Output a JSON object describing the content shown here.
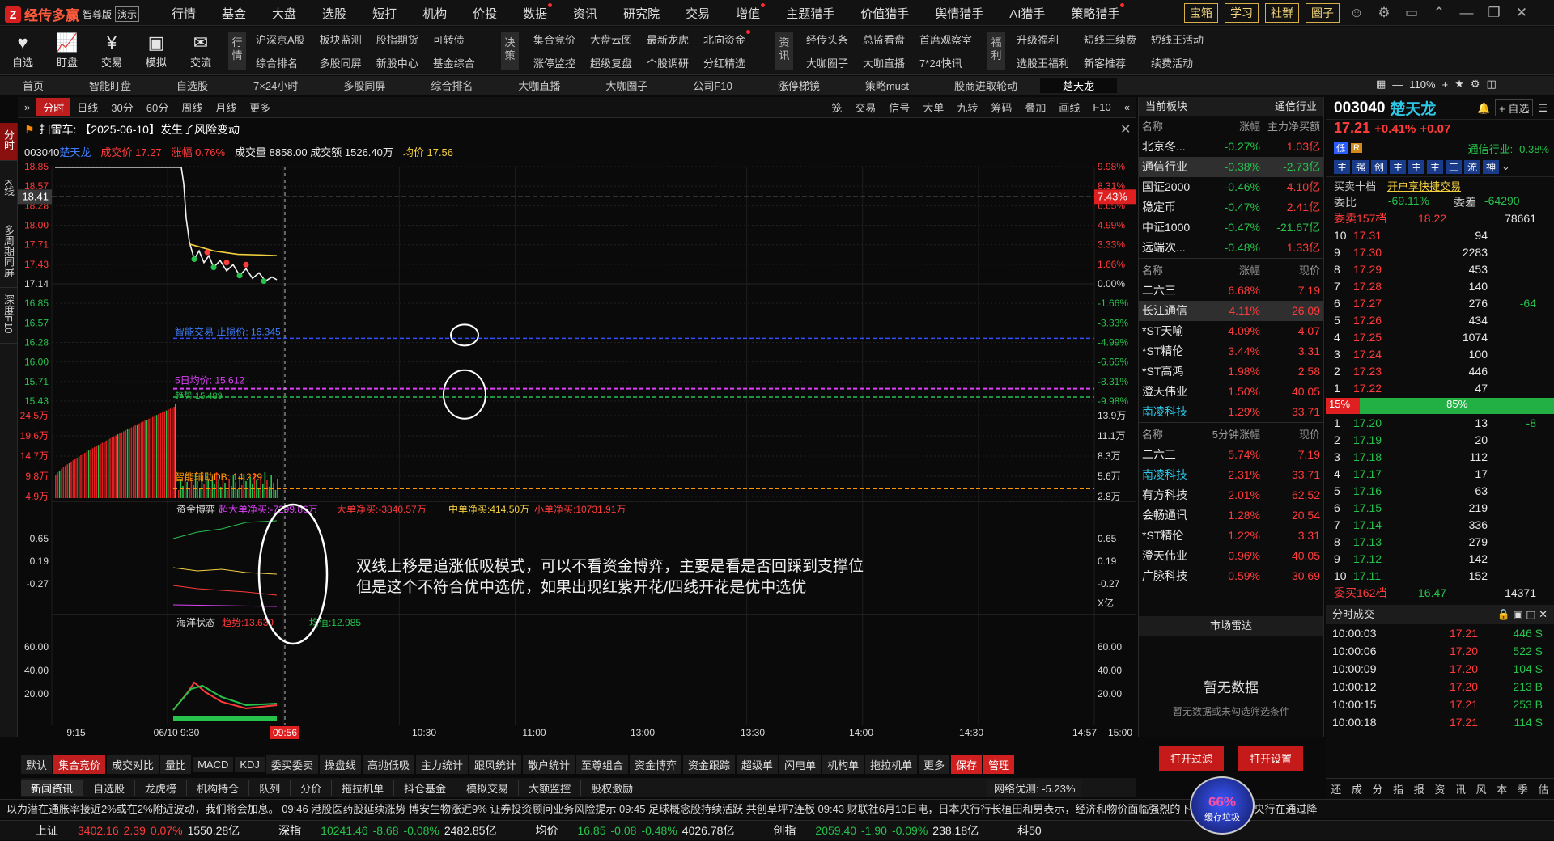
{
  "app": {
    "logo": "经传多赢",
    "edition": "智尊版",
    "demo": "演示"
  },
  "topmenu": [
    {
      "label": "行情",
      "dot": false
    },
    {
      "label": "基金",
      "dot": false
    },
    {
      "label": "大盘",
      "dot": false
    },
    {
      "label": "选股",
      "dot": false
    },
    {
      "label": "短打",
      "dot": false
    },
    {
      "label": "机构",
      "dot": false
    },
    {
      "label": "价投",
      "dot": false
    },
    {
      "label": "数据",
      "dot": true
    },
    {
      "label": "资讯",
      "dot": false
    },
    {
      "label": "研究院",
      "dot": false
    },
    {
      "label": "交易",
      "dot": false
    },
    {
      "label": "增值",
      "dot": true
    },
    {
      "label": "主题猎手",
      "dot": false
    },
    {
      "label": "价值猎手",
      "dot": false
    },
    {
      "label": "舆情猎手",
      "dot": false
    },
    {
      "label": "AI猎手",
      "dot": false
    },
    {
      "label": "策略猎手",
      "dot": true
    }
  ],
  "topright": [
    "宝箱",
    "学习",
    "社群",
    "圈子"
  ],
  "tool2": {
    "big": [
      "自选",
      "盯盘",
      "交易",
      "模拟",
      "交流"
    ],
    "tag1": "行情",
    "grid1": [
      "沪深京A股",
      "板块监测",
      "股指期货",
      "可转债",
      "综合排名",
      "多股同屏",
      "新股中心",
      "基金综合"
    ],
    "tag2": "决策",
    "grid2": [
      "集合竞价",
      "大盘云图",
      "最新龙虎",
      "北向资金",
      "涨停监控",
      "超级复盘",
      "个股调研",
      "分红精选"
    ],
    "tag3": "资讯",
    "grid3": [
      "经传头条",
      "总监看盘",
      "首席观察室",
      "大咖圈子",
      "大咖直播",
      "7*24快讯"
    ],
    "tag4": "福利",
    "grid4": [
      "升级福利",
      "短线王续费",
      "短线王活动",
      "选股王福利",
      "新客推荐",
      "续费活动"
    ]
  },
  "tabs": [
    "首页",
    "智能盯盘",
    "自选股",
    "7×24小时",
    "多股同屏",
    "综合排名",
    "大咖直播",
    "大咖圈子",
    "公司F10",
    "涨停梯镜",
    "策略must",
    "股商进取轮动",
    "楚天龙"
  ],
  "zoom": "110%",
  "lnav": [
    "分时",
    "K线",
    "多周期同屏",
    "深度F10"
  ],
  "ctool": {
    "left": [
      "分时",
      "日线",
      "30分",
      "60分",
      "周线",
      "月线",
      "更多"
    ],
    "right": [
      "笼",
      "交易",
      "信号",
      "大单",
      "九转",
      "筹码",
      "叠加",
      "画线",
      "F10"
    ]
  },
  "alert": "扫雷车: 【2025-06-10】发生了风险变动",
  "stock": {
    "code": "003040",
    "name": "楚天龙",
    "price_lbl": "成交价 17.27",
    "chg_lbl": "涨幅 0.76%",
    "vol_lbl": "成交量 8858.00 成交额 1526.40万",
    "avg_lbl": "均价 17.56"
  },
  "chart": {
    "price_axis": [
      "18.85",
      "18.57",
      "18.28",
      "18.00",
      "17.71",
      "17.43",
      "17.14",
      "16.85",
      "16.57",
      "16.28",
      "16.00",
      "15.71",
      "15.43"
    ],
    "pct_axis": [
      "9.98%",
      "8.31%",
      "6.65%",
      "4.99%",
      "3.33%",
      "1.66%",
      "0.00%",
      "-1.66%",
      "-3.33%",
      "-4.99%",
      "-6.65%",
      "-8.31%",
      "-9.98%"
    ],
    "cursor_price": "18.41",
    "cursor_pct": "7.43%",
    "vol_axis": [
      "24.5万",
      "19.6万",
      "14.7万",
      "9.8万",
      "4.9万"
    ],
    "vol_axis_r": [
      "13.9万",
      "11.1万",
      "8.3万",
      "5.6万",
      "2.8万"
    ],
    "stop_label": "智能交易 止损价: 16.345",
    "ma5_label": "5日均价: 15.612",
    "other_label": "趋势 15.489",
    "db_label": "智能辅助DB: 14.229",
    "fund_title": "资金博弈",
    "fund_super": "超大单净买:-7299.86万",
    "fund_big": "大单净买:-3840.57万",
    "fund_mid": "中单净买:414.50万",
    "fund_small": "小单净买:10731.91万",
    "fund_axis": [
      "0.65",
      "0.19",
      "-0.27"
    ],
    "fund_unit": "X亿",
    "ocean_title": "海洋状态",
    "ocean_trend": "趋势:13.639",
    "ocean_avg": "均值:12.985",
    "ocean_axis": [
      "60.00",
      "40.00",
      "20.00"
    ],
    "time_axis": [
      "9:15",
      "06/10 9:30",
      "10:30",
      "11:00",
      "13:00",
      "13:30",
      "14:00",
      "14:30",
      "14:57",
      "15:00"
    ],
    "cursor_time": "09:56"
  },
  "note": [
    "双线上移是追涨低吸模式，可以不看资金博弈，主要是看是否回踩到支撑位",
    "但是这个不符合优中选优，如果出现红紫开花/四线开花是优中选优"
  ],
  "btabs": [
    "默认",
    "集合竞价",
    "成交对比",
    "量比",
    "MACD",
    "KDJ",
    "委买委卖",
    "操盘线",
    "高抛低吸",
    "主力统计",
    "跟风统计",
    "散户统计",
    "至尊组合",
    "资金博弈",
    "资金跟踪",
    "超级单",
    "闪电单",
    "机构单",
    "拖拉机单",
    "更多",
    "保存",
    "管理"
  ],
  "ntabs": [
    "新闻资讯",
    "自选股",
    "龙虎榜",
    "机构持仓",
    "队列",
    "分价",
    "拖拉机单",
    "抖仓基金",
    "模拟交易",
    "大额监控",
    "股权激励"
  ],
  "net": "网络优测: -5.23%",
  "ticker": "以为潜在通胀率接近2%或在2%附近波动，我们将会加息。  09:46 港股医药股延续涨势 博安生物涨近9%    证券投资顾问业务风险提示    09:45 足球概念股持续活跃 共创草坪7连板    09:43 财联社6月10日电，日本央行行长植田和男表示，经济和物价面临强烈的下行压力，日本央行在通过降",
  "index": [
    {
      "n": "上证",
      "v": "3402.16",
      "c": "2.39",
      "p": "0.07%",
      "a": "1550.28亿"
    },
    {
      "n": "深指",
      "v": "10241.46",
      "c": "-8.68",
      "p": "-0.08%",
      "a": "2482.85亿"
    },
    {
      "n": "均价",
      "v": "16.85",
      "c": "-0.08",
      "p": "-0.48%",
      "a": "4026.78亿"
    },
    {
      "n": "创指",
      "v": "2059.40",
      "c": "-1.90",
      "p": "-0.09%",
      "a": "238.18亿"
    },
    {
      "n": "科50",
      "v": "",
      "c": "",
      "p": "",
      "a": ""
    }
  ],
  "mid": {
    "title": "当前板块",
    "filter": "通信行业",
    "h1": [
      "名称",
      "涨幅",
      "主力净买额"
    ],
    "s1": [
      [
        "北京冬...",
        "-0.27%",
        "1.03亿"
      ],
      [
        "通信行业",
        "-0.38%",
        "-2.73亿"
      ],
      [
        "国证2000",
        "-0.46%",
        "4.10亿"
      ],
      [
        "稳定币",
        "-0.47%",
        "2.41亿"
      ],
      [
        "中证1000",
        "-0.47%",
        "-21.67亿"
      ],
      [
        "远端次...",
        "-0.48%",
        "1.33亿"
      ]
    ],
    "h2": [
      "名称",
      "涨幅",
      "现价"
    ],
    "s2": [
      [
        "二六三",
        "6.68%",
        "7.19"
      ],
      [
        "长江通信",
        "4.11%",
        "26.09"
      ],
      [
        "*ST天喻",
        "4.09%",
        "4.07"
      ],
      [
        "*ST精伦",
        "3.44%",
        "3.31"
      ],
      [
        "*ST高鸿",
        "1.98%",
        "2.58"
      ],
      [
        "澄天伟业",
        "1.50%",
        "40.05"
      ],
      [
        "南凌科技",
        "1.29%",
        "33.71"
      ]
    ],
    "h3": [
      "名称",
      "5分钟涨幅",
      "现价"
    ],
    "s3": [
      [
        "二六三",
        "5.74%",
        "7.19"
      ],
      [
        "南凌科技",
        "2.31%",
        "33.71"
      ],
      [
        "有方科技",
        "2.01%",
        "62.52"
      ],
      [
        "会畅通讯",
        "1.28%",
        "20.54"
      ],
      [
        "*ST精伦",
        "1.22%",
        "3.31"
      ],
      [
        "澄天伟业",
        "0.96%",
        "40.05"
      ],
      [
        "广脉科技",
        "0.59%",
        "30.69"
      ]
    ],
    "radar": "市场雷达",
    "nodata": "暂无数据",
    "nodata_sub": "暂无数据或未勾选筛选条件",
    "btn1": "打开过滤",
    "btn2": "打开设置"
  },
  "right": {
    "code": "003040",
    "name": "楚天龙",
    "price": "17.21",
    "chg": "+0.41%",
    "chgv": "+0.07",
    "add": "+ 自选",
    "industry": "通信行业: -0.38%",
    "tags": [
      "主",
      "强",
      "创",
      "主",
      "主",
      "主",
      "三",
      "流",
      "神"
    ],
    "ob_title": "买卖十档",
    "ob_link": "开户享快捷交易",
    "weibi": "委比",
    "weibi_v": "-69.11%",
    "weicha": "委差",
    "weicha_v": "-64290",
    "sell_total": "委卖157档",
    "sell_total_p": "18.22",
    "sell_total_v": "78661",
    "asks": [
      [
        "10",
        "17.31",
        "94",
        ""
      ],
      [
        "9",
        "17.30",
        "2283",
        ""
      ],
      [
        "8",
        "17.29",
        "453",
        ""
      ],
      [
        "7",
        "17.28",
        "140",
        ""
      ],
      [
        "6",
        "17.27",
        "276",
        "-64"
      ],
      [
        "5",
        "17.26",
        "434",
        ""
      ],
      [
        "4",
        "17.25",
        "1074",
        ""
      ],
      [
        "3",
        "17.24",
        "100",
        ""
      ],
      [
        "2",
        "17.23",
        "446",
        ""
      ],
      [
        "1",
        "17.22",
        "47",
        ""
      ]
    ],
    "ratio_l": "15%",
    "ratio_r": "85%",
    "bids": [
      [
        "1",
        "17.20",
        "13",
        "-8"
      ],
      [
        "2",
        "17.19",
        "20",
        ""
      ],
      [
        "3",
        "17.18",
        "112",
        ""
      ],
      [
        "4",
        "17.17",
        "17",
        ""
      ],
      [
        "5",
        "17.16",
        "63",
        ""
      ],
      [
        "6",
        "17.15",
        "219",
        ""
      ],
      [
        "7",
        "17.14",
        "336",
        ""
      ],
      [
        "8",
        "17.13",
        "279",
        ""
      ],
      [
        "9",
        "17.12",
        "142",
        ""
      ],
      [
        "10",
        "17.11",
        "152",
        ""
      ]
    ],
    "buy_total": "委买162档",
    "buy_total_p": "16.47",
    "buy_total_v": "14371",
    "ticks_title": "分时成交",
    "ticks": [
      [
        "10:00:03",
        "17.21",
        "446 S"
      ],
      [
        "10:00:06",
        "17.20",
        "522 S"
      ],
      [
        "10:00:09",
        "17.20",
        "104 S"
      ],
      [
        "10:00:12",
        "17.20",
        "213 B"
      ],
      [
        "10:00:15",
        "17.21",
        "253 B"
      ],
      [
        "10:00:18",
        "17.21",
        "114 S"
      ]
    ],
    "bottom_icons": [
      "还",
      "成",
      "分",
      "指",
      "报",
      "资",
      "讯",
      "风",
      "本",
      "季",
      "估"
    ]
  },
  "memball": {
    "pct": "66%",
    "label": "缓存垃圾"
  }
}
